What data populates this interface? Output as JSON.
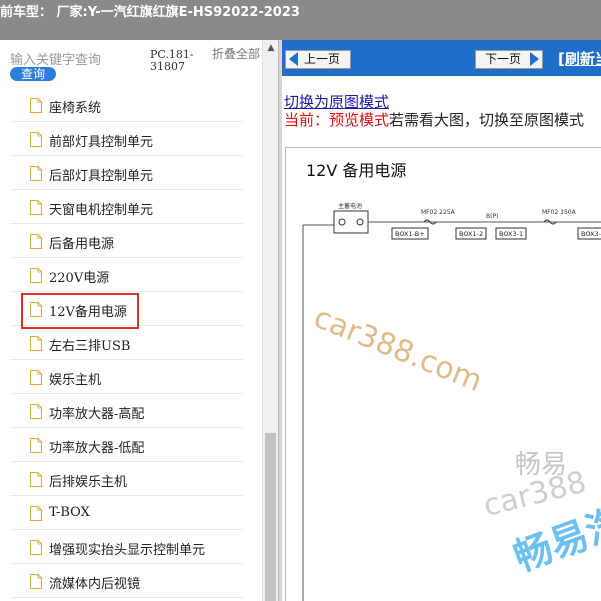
{
  "header": {
    "title": "前车型：  厂家:Y-一汽红旗红旗E-HS92022-2023"
  },
  "sidebar": {
    "search_placeholder": "输入关键字查询",
    "search_button": "查询",
    "pc_code": "PC.181-31807",
    "collapse_all": "折叠全部",
    "items": [
      {
        "label": "座椅系统"
      },
      {
        "label": "前部灯具控制单元"
      },
      {
        "label": "后部灯具控制单元"
      },
      {
        "label": "天窗电机控制单元"
      },
      {
        "label": "后备用电源"
      },
      {
        "label": "220V电源"
      },
      {
        "label": "12V备用电源"
      },
      {
        "label": "左右三排USB"
      },
      {
        "label": "娱乐主机"
      },
      {
        "label": "功率放大器-高配"
      },
      {
        "label": "功率放大器-低配"
      },
      {
        "label": "后排娱乐主机"
      },
      {
        "label": "T-BOX"
      },
      {
        "label": "增强现实抬头显示控制单元"
      },
      {
        "label": "流媒体内后视镜"
      }
    ],
    "selected_index": 6
  },
  "toolbar": {
    "prev_label": "上一页",
    "next_label": "下一页",
    "refresh_label": "[刷新当"
  },
  "content": {
    "switch_link": "切换为原图模式",
    "status_current": "当前：预览模式",
    "status_hint": "若需看大图，切换至原图模式"
  },
  "diagram": {
    "title": "12V 备用电源",
    "battery_label": "主蓄电池",
    "fuse1_label": "MF02 225A",
    "node_label": "B(P)",
    "fuse2_label": "MF02 150A",
    "box1": "BOX1-B+",
    "box2": "BOX1-2",
    "box3": "BOX3-1",
    "box4": "BOX3-"
  },
  "watermarks": {
    "w1": "car388.com",
    "w2": "畅易",
    "w3": "car388",
    "w4": "畅易汽"
  },
  "colors": {
    "header_bg": "#8a8a8a",
    "navbar_bg": "#1f6ec9",
    "search_button_bg": "#2b7fd8",
    "selected_border": "#d9322b",
    "status_red": "#d11"
  }
}
